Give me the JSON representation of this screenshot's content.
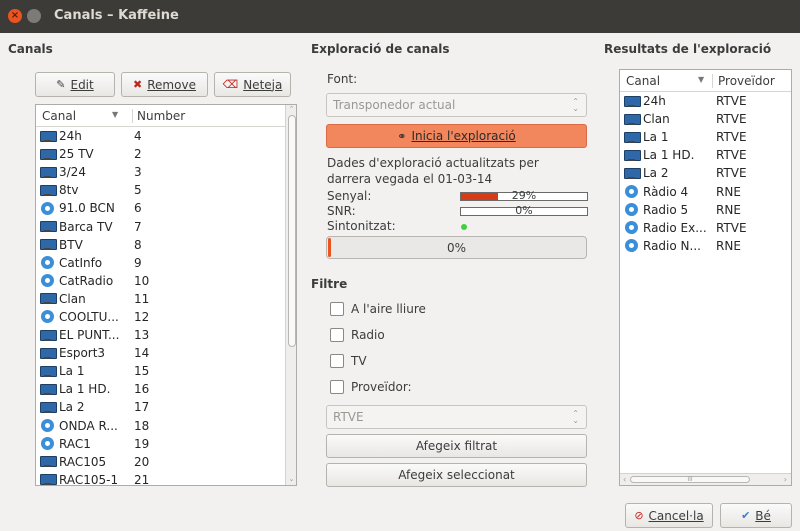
{
  "window": {
    "title": "Canals – Kaffeine"
  },
  "left": {
    "header": "Canals",
    "buttons": {
      "edit": "Edit",
      "remove": "Remove",
      "clear": "Neteja"
    },
    "columns": {
      "canal": "Canal",
      "number": "Number"
    },
    "rows": [
      {
        "type": "tv",
        "name": "24h",
        "number": "4"
      },
      {
        "type": "tv",
        "name": "25 TV",
        "number": "2"
      },
      {
        "type": "tv",
        "name": "3/24",
        "number": "3"
      },
      {
        "type": "tv",
        "name": "8tv",
        "number": "5"
      },
      {
        "type": "radio",
        "name": "91.0 BCN",
        "number": "6"
      },
      {
        "type": "tv",
        "name": "Barca TV",
        "number": "7"
      },
      {
        "type": "tv",
        "name": "BTV",
        "number": "8"
      },
      {
        "type": "radio",
        "name": "CatInfo",
        "number": "9"
      },
      {
        "type": "radio",
        "name": "CatRadio",
        "number": "10"
      },
      {
        "type": "tv",
        "name": "Clan",
        "number": "11"
      },
      {
        "type": "radio",
        "name": "COOLTU...",
        "number": "12"
      },
      {
        "type": "tv",
        "name": "EL PUNT...",
        "number": "13"
      },
      {
        "type": "tv",
        "name": "Esport3",
        "number": "14"
      },
      {
        "type": "tv",
        "name": "La 1",
        "number": "15"
      },
      {
        "type": "tv",
        "name": "La 1 HD.",
        "number": "16"
      },
      {
        "type": "tv",
        "name": "La 2",
        "number": "17"
      },
      {
        "type": "radio",
        "name": "ONDA R...",
        "number": "18"
      },
      {
        "type": "radio",
        "name": "RAC1",
        "number": "19"
      },
      {
        "type": "tv",
        "name": "RAC105",
        "number": "20"
      },
      {
        "type": "tv",
        "name": "RAC105-1",
        "number": "21"
      }
    ]
  },
  "middle": {
    "header": "Exploració de canals",
    "font_label": "Font:",
    "source_combo": "Transponedor actual",
    "start_button": "Inicia l'exploració",
    "data_info": "Dades d'exploració actualitzats per darrera vegada el 01-03-14",
    "signal_label": "Senyal:",
    "signal_value": "29%",
    "signal_fraction": 0.29,
    "snr_label": "SNR:",
    "snr_value": "0%",
    "tuned_label": "Sintonitzat:",
    "progress_value": "0%",
    "filter_header": "Filtre",
    "filters": {
      "free_air": "A l'aire lliure",
      "radio": "Radio",
      "tv": "TV",
      "provider": "Proveïdor:"
    },
    "provider_combo": "RTVE",
    "add_filtered": "Afegeix filtrat",
    "add_selected": "Afegeix seleccionat"
  },
  "right": {
    "header": "Resultats de l'exploració",
    "columns": {
      "canal": "Canal",
      "provider": "Proveïdor"
    },
    "rows": [
      {
        "type": "tv",
        "name": "24h",
        "provider": "RTVE"
      },
      {
        "type": "tv",
        "name": "Clan",
        "provider": "RTVE"
      },
      {
        "type": "tv",
        "name": "La 1",
        "provider": "RTVE"
      },
      {
        "type": "tv",
        "name": "La 1 HD.",
        "provider": "RTVE"
      },
      {
        "type": "tv",
        "name": "La 2",
        "provider": "RTVE"
      },
      {
        "type": "radio",
        "name": "Ràdio 4",
        "provider": "RNE"
      },
      {
        "type": "radio",
        "name": "Radio 5",
        "provider": "RNE"
      },
      {
        "type": "radio",
        "name": "Radio Ex...",
        "provider": "RTVE"
      },
      {
        "type": "radio",
        "name": "Radio N...",
        "provider": "RNE"
      }
    ],
    "hscroll_glyph": "III"
  },
  "footer": {
    "cancel": "Cancel·la",
    "ok": "Bé"
  },
  "colors": {
    "titlebar": "#3c3b37",
    "accent": "#f2875d",
    "close": "#e95420",
    "meter_fill": "#d43b16"
  }
}
